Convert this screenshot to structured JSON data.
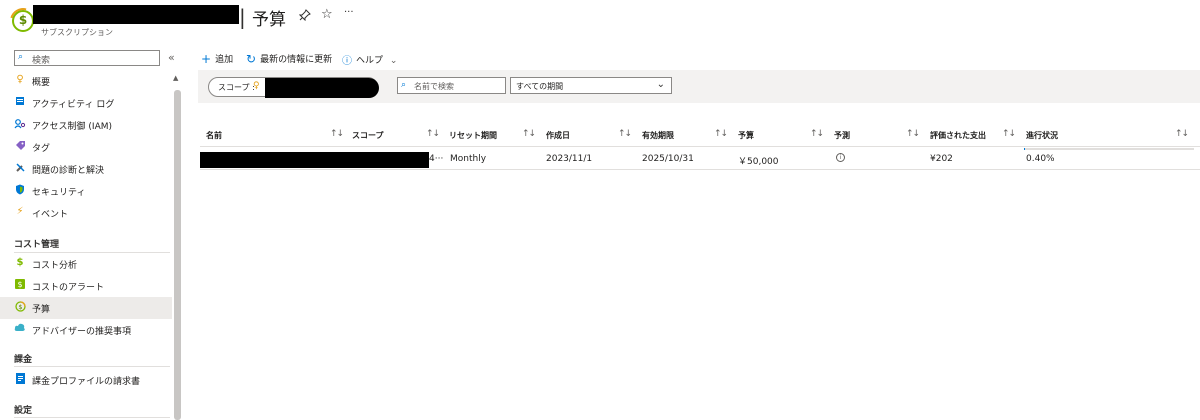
{
  "header": {
    "title": "予算",
    "subtitle": "サブスクリプション",
    "pin_icon": "pin-icon",
    "star_icon": "star-icon",
    "more_label": "···"
  },
  "sidebar": {
    "search_placeholder": "検索",
    "collapse_label": "«",
    "items": [
      {
        "label": "概要",
        "icon": "key-icon"
      },
      {
        "label": "アクティビティ ログ",
        "icon": "activity-log-icon"
      },
      {
        "label": "アクセス制御 (IAM)",
        "icon": "iam-icon"
      },
      {
        "label": "タグ",
        "icon": "tag-icon"
      },
      {
        "label": "問題の診断と解決",
        "icon": "wrench-icon"
      },
      {
        "label": "セキュリティ",
        "icon": "shield-icon"
      },
      {
        "label": "イベント",
        "icon": "lightning-icon"
      }
    ],
    "sections": [
      {
        "label": "コスト管理",
        "items": [
          {
            "label": "コスト分析",
            "icon": "cost-analysis-icon"
          },
          {
            "label": "コストのアラート",
            "icon": "cost-alert-icon"
          },
          {
            "label": "予算",
            "icon": "budget-icon",
            "active": true
          },
          {
            "label": "アドバイザーの推奨事項",
            "icon": "advisor-icon"
          }
        ]
      },
      {
        "label": "課金",
        "items": [
          {
            "label": "課金プロファイルの請求書",
            "icon": "invoice-icon"
          }
        ]
      },
      {
        "label": "設定",
        "items": []
      }
    ]
  },
  "toolbar": {
    "add_label": "追加",
    "refresh_label": "最新の情報に更新",
    "help_label": "ヘルプ"
  },
  "filters": {
    "scope_label": "スコープ :",
    "search_placeholder": "名前で検索",
    "period_value": "すべての期間"
  },
  "table": {
    "columns": [
      "名前",
      "スコープ",
      "リセット期間",
      "作成日",
      "有効期限",
      "予算",
      "予測",
      "評価された支出",
      "進行状況"
    ],
    "rows": [
      {
        "scope_suffix": "4···",
        "reset_period": "Monthly",
        "created": "2023/11/1",
        "expires": "2025/10/31",
        "budget": "￥50,000",
        "forecast_icon": "info-icon",
        "evaluated_spend": "¥202",
        "progress": "0.40%",
        "progress_fraction": 0.004
      }
    ]
  },
  "colors": {
    "accent": "#0078d4",
    "subscription_icon": "#7fba00",
    "key": "#e6a118"
  }
}
